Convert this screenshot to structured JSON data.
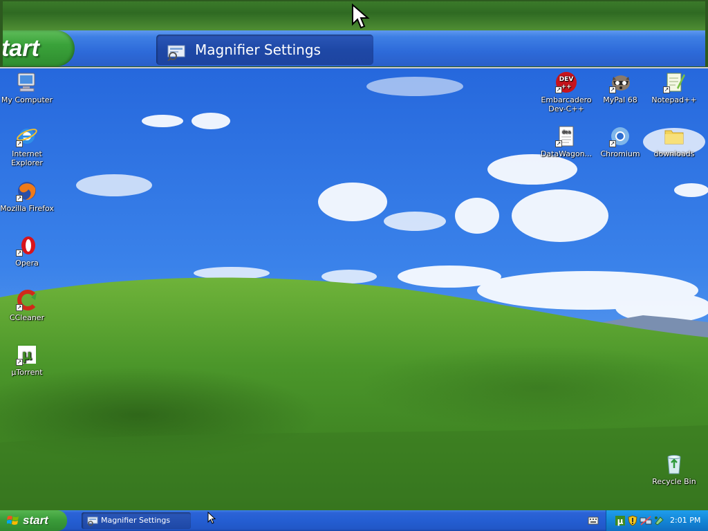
{
  "magnifier": {
    "start_label": "tart",
    "task_label": "Magnifier Settings"
  },
  "desktop": {
    "left_icons": [
      {
        "label": "My Computer",
        "icon": "my-computer-icon"
      },
      {
        "label": "Internet Explorer",
        "icon": "internet-explorer-icon"
      },
      {
        "label": "Mozilla Firefox",
        "icon": "firefox-icon"
      },
      {
        "label": "Opera",
        "icon": "opera-icon"
      },
      {
        "label": "CCleaner",
        "icon": "ccleaner-icon"
      },
      {
        "label": "µTorrent",
        "icon": "utorrent-icon"
      }
    ],
    "right_icons": [
      {
        "label": "Embarcadero Dev-C++",
        "icon": "devcpp-icon"
      },
      {
        "label": "MyPal 68",
        "icon": "mypal-icon"
      },
      {
        "label": "Notepad++",
        "icon": "notepadpp-icon"
      },
      {
        "label": "DataWagon...",
        "icon": "datawagon-icon"
      },
      {
        "label": "Chromium",
        "icon": "chromium-icon"
      },
      {
        "label": "downloads",
        "icon": "folder-icon"
      }
    ],
    "recycle_bin": {
      "label": "Recycle Bin",
      "icon": "recycle-bin-icon"
    }
  },
  "taskbar": {
    "start_label": "start",
    "task_label": "Magnifier Settings",
    "clock": "2:01 PM"
  },
  "colors": {
    "sky": "#2f6fe0",
    "hill": "#4e9a2a",
    "taskbar": "#245ed2",
    "start": "#3b9d3a",
    "tray": "#1486d7"
  }
}
